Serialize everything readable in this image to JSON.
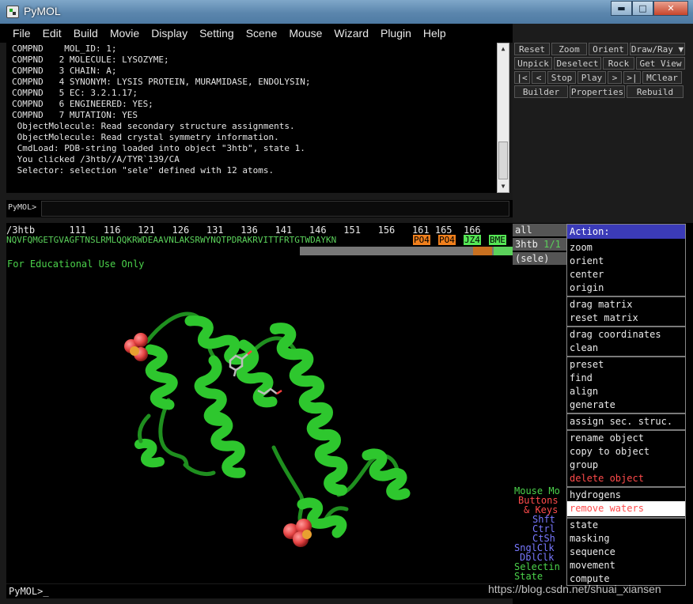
{
  "window": {
    "title": "PyMOL",
    "minimize": "▬",
    "maximize": "□",
    "close": "✕"
  },
  "menu": [
    "File",
    "Edit",
    "Build",
    "Movie",
    "Display",
    "Setting",
    "Scene",
    "Mouse",
    "Wizard",
    "Plugin",
    "Help"
  ],
  "log": [
    "COMPND    MOL_ID: 1;",
    "COMPND   2 MOLECULE: LYSOZYME;",
    "COMPND   3 CHAIN: A;",
    "COMPND   4 SYNONYM: LYSIS PROTEIN, MURAMIDASE, ENDOLYSIN;",
    "COMPND   5 EC: 3.2.1.17;",
    "COMPND   6 ENGINEERED: YES;",
    "COMPND   7 MUTATION: YES",
    " ObjectMolecule: Read secondary structure assignments.",
    " ObjectMolecule: Read crystal symmetry information.",
    " CmdLoad: PDB-string loaded into object \"3htb\", state 1.",
    " You clicked /3htb//A/TYR`139/CA",
    " Selector: selection \"sele\" defined with 12 atoms."
  ],
  "prompt": "PyMOL>",
  "cmd_value": "",
  "buttons": {
    "row1": [
      "Reset",
      "Zoom",
      "Orient",
      "Draw/Ray ▼"
    ],
    "row2": [
      "Unpick",
      "Deselect",
      "Rock",
      "Get View"
    ],
    "row3": [
      "|<",
      "<",
      "Stop",
      "Play",
      ">",
      ">|",
      "MClear"
    ],
    "row4": [
      "Builder",
      "Properties",
      "Rebuild"
    ]
  },
  "sequence": {
    "header": "/3htb      111   116   121   126   131   136   141   146   151   156   161 165  166",
    "residues": "NQVFQMGETGVAGFTNSLRMLQQKRWDEAAVNLAKSRWYNQTPDRAKRVITTFRTGTWDAYKN",
    "ligands": [
      {
        "label": "PO4",
        "color": "#f07f1c"
      },
      {
        "label": "PO4",
        "color": "#f07f1c"
      },
      {
        "label": "JZ4",
        "color": "#55e655"
      },
      {
        "label": "BME",
        "color": "#55e655"
      }
    ]
  },
  "viewport_label": "For Educational Use Only",
  "objects": [
    {
      "name": "all",
      "state": ""
    },
    {
      "name": "3htb",
      "state": "1/1"
    },
    {
      "name": "(sele)",
      "state": ""
    }
  ],
  "action_menu": {
    "title": "Action:",
    "groups": [
      [
        {
          "label": "zoom"
        },
        {
          "label": "orient"
        },
        {
          "label": "center"
        },
        {
          "label": "origin"
        }
      ],
      [
        {
          "label": "drag matrix"
        },
        {
          "label": "reset matrix"
        }
      ],
      [
        {
          "label": "drag coordinates"
        },
        {
          "label": "clean"
        }
      ],
      [
        {
          "label": "preset"
        },
        {
          "label": "find"
        },
        {
          "label": "align"
        },
        {
          "label": "generate"
        }
      ],
      [
        {
          "label": "assign sec. struc."
        }
      ],
      [
        {
          "label": "rename object"
        },
        {
          "label": "copy to object"
        },
        {
          "label": "group"
        },
        {
          "label": "delete object",
          "style": "red"
        }
      ],
      [
        {
          "label": "hydrogens"
        },
        {
          "label": "remove waters",
          "style": "highlight"
        }
      ],
      [
        {
          "label": "state"
        },
        {
          "label": "masking"
        },
        {
          "label": "sequence"
        },
        {
          "label": "movement"
        },
        {
          "label": "compute"
        }
      ]
    ]
  },
  "mouse_panel": [
    {
      "text": "Mouse Mo",
      "color": "#4bd24b"
    },
    {
      "text": "Buttons",
      "color": "#ff4b4b"
    },
    {
      "text": "& Keys",
      "color": "#ff4b4b"
    },
    {
      "text": "Shft",
      "color": "#7878ff"
    },
    {
      "text": "Ctrl",
      "color": "#7878ff"
    },
    {
      "text": "CtSh",
      "color": "#7878ff"
    },
    {
      "text": "SnglClk",
      "color": "#7878ff"
    },
    {
      "text": "DblClk",
      "color": "#7878ff"
    },
    {
      "text": "Selectin",
      "color": "#4bd24b"
    },
    {
      "text": "State",
      "color": "#4bd24b"
    }
  ],
  "bottom_prompt": "PyMOL>_",
  "watermark": "https://blog.csdn.net/shuai_xiansen",
  "colors": {
    "protein": "#2ec72e",
    "phosphate": "#e64545",
    "ligand": "#c0c0c0"
  }
}
